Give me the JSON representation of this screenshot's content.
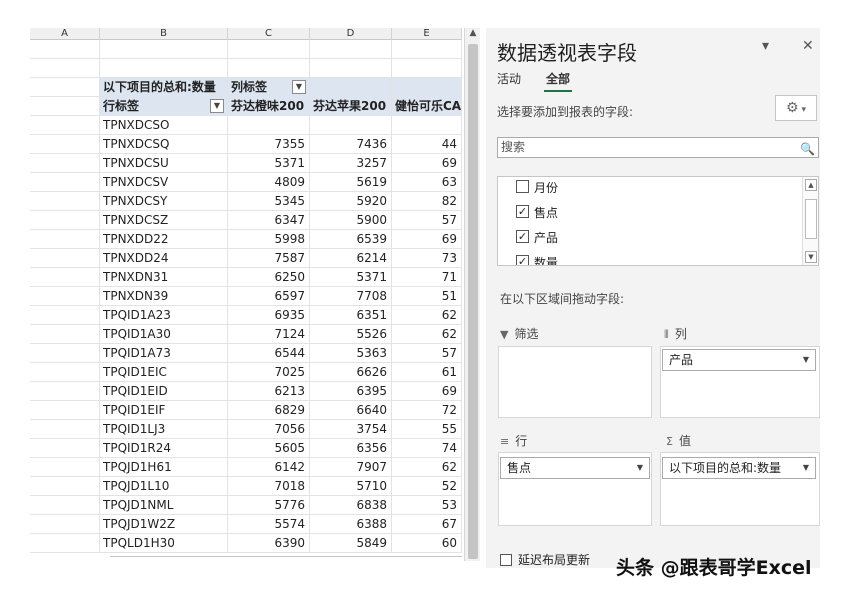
{
  "sheet": {
    "columns": [
      "A",
      "B",
      "C",
      "D",
      "E"
    ],
    "pivot_header": {
      "values_label": "以下项目的总和:数量",
      "column_labels": "列标签",
      "row_labels": "行标签",
      "col_headers": [
        "芬达橙味200",
        "芬达苹果200",
        "健怡可乐CA"
      ]
    },
    "rows": [
      {
        "label": "TPNXDCSO",
        "c": "",
        "d": "",
        "e": ""
      },
      {
        "label": "TPNXDCSQ",
        "c": "7355",
        "d": "7436",
        "e": "44"
      },
      {
        "label": "TPNXDCSU",
        "c": "5371",
        "d": "3257",
        "e": "69"
      },
      {
        "label": "TPNXDCSV",
        "c": "4809",
        "d": "5619",
        "e": "63"
      },
      {
        "label": "TPNXDCSY",
        "c": "5345",
        "d": "5920",
        "e": "82"
      },
      {
        "label": "TPNXDCSZ",
        "c": "6347",
        "d": "5900",
        "e": "57"
      },
      {
        "label": "TPNXDD22",
        "c": "5998",
        "d": "6539",
        "e": "69"
      },
      {
        "label": "TPNXDD24",
        "c": "7587",
        "d": "6214",
        "e": "73"
      },
      {
        "label": "TPNXDN31",
        "c": "6250",
        "d": "5371",
        "e": "71"
      },
      {
        "label": "TPNXDN39",
        "c": "6597",
        "d": "7708",
        "e": "51"
      },
      {
        "label": "TPQID1A23",
        "c": "6935",
        "d": "6351",
        "e": "62"
      },
      {
        "label": "TPQID1A30",
        "c": "7124",
        "d": "5526",
        "e": "62"
      },
      {
        "label": "TPQID1A73",
        "c": "6544",
        "d": "5363",
        "e": "57"
      },
      {
        "label": "TPQID1EIC",
        "c": "7025",
        "d": "6626",
        "e": "61"
      },
      {
        "label": "TPQID1EID",
        "c": "6213",
        "d": "6395",
        "e": "69"
      },
      {
        "label": "TPQID1EIF",
        "c": "6829",
        "d": "6640",
        "e": "72"
      },
      {
        "label": "TPQID1LJ3",
        "c": "7056",
        "d": "3754",
        "e": "55"
      },
      {
        "label": "TPQID1R24",
        "c": "5605",
        "d": "6356",
        "e": "74"
      },
      {
        "label": "TPQJD1H61",
        "c": "6142",
        "d": "7907",
        "e": "62"
      },
      {
        "label": "TPQJD1L10",
        "c": "7018",
        "d": "5710",
        "e": "52"
      },
      {
        "label": "TPQJD1NML",
        "c": "5776",
        "d": "6838",
        "e": "53"
      },
      {
        "label": "TPQJD1W2Z",
        "c": "5574",
        "d": "6388",
        "e": "67"
      },
      {
        "label": "TPQLD1H30",
        "c": "6390",
        "d": "5849",
        "e": "60"
      }
    ]
  },
  "panel": {
    "title": "数据透视表字段",
    "tabs": [
      "活动",
      "全部"
    ],
    "hint": "选择要添加到报表的字段:",
    "search_placeholder": "搜索",
    "fields": [
      {
        "name": "月份",
        "checked": false
      },
      {
        "name": "售点",
        "checked": true
      },
      {
        "name": "产品",
        "checked": true
      },
      {
        "name": "数量",
        "checked": true
      }
    ],
    "drag_hint": "在以下区域间拖动字段:",
    "areas": {
      "filter": "筛选",
      "columns": "列",
      "rows": "行",
      "values": "值"
    },
    "columns_field": "产品",
    "rows_field": "售点",
    "values_field": "以下项目的总和:数量",
    "defer_label": "延迟布局更新"
  },
  "watermark": "头条 @跟表哥学Excel"
}
